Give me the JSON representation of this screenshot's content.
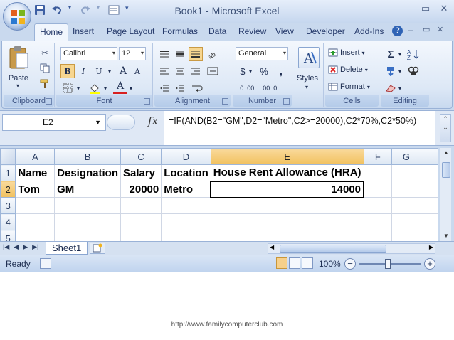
{
  "window": {
    "title": "Book1 - Microsoft Excel"
  },
  "ribbon": {
    "tabs": [
      "Home",
      "Insert",
      "Page Layout",
      "Formulas",
      "Data",
      "Review",
      "View",
      "Developer",
      "Add-Ins"
    ],
    "active_tab": "Home",
    "clipboard": {
      "label": "Clipboard",
      "paste": "Paste"
    },
    "font": {
      "label": "Font",
      "name": "Calibri",
      "size": "12",
      "bold": "B",
      "italic": "I",
      "underline": "U",
      "grow": "A",
      "shrink": "A",
      "color": "A"
    },
    "alignment": {
      "label": "Alignment"
    },
    "number": {
      "label": "Number",
      "format": "General",
      "currency": "$",
      "percent": "%",
      "comma": ",",
      "inc_decimal": ".0 .00",
      "dec_decimal": ".00 .0"
    },
    "styles": {
      "label": "Styles"
    },
    "cells": {
      "label": "Cells",
      "insert": "Insert",
      "delete": "Delete",
      "format": "Format"
    },
    "editing": {
      "label": "Editing",
      "sum": "Σ"
    }
  },
  "formula_bar": {
    "name_box": "E2",
    "fx": "fx",
    "formula": "=IF(AND(B2=\"GM\",D2=\"Metro\",C2>=20000),C2*70%,C2*50%)"
  },
  "sheet": {
    "columns": [
      "A",
      "B",
      "C",
      "D",
      "E",
      "F",
      "G"
    ],
    "selected_column": "E",
    "rows": [
      {
        "num": "1",
        "cells": [
          "Name",
          "Designation",
          "Salary",
          "Location",
          "House Rent Allowance (HRA)",
          "",
          ""
        ]
      },
      {
        "num": "2",
        "cells": [
          "Tom",
          "GM",
          "20000",
          "Metro",
          "14000",
          "",
          ""
        ]
      },
      {
        "num": "3",
        "cells": [
          "",
          "",
          "",
          "",
          "",
          "",
          ""
        ]
      },
      {
        "num": "4",
        "cells": [
          "",
          "",
          "",
          "",
          "",
          "",
          ""
        ]
      },
      {
        "num": "5",
        "cells": [
          "",
          "",
          "",
          "",
          "",
          "",
          ""
        ]
      }
    ],
    "active_cell": "E2",
    "tab_name": "Sheet1"
  },
  "status_bar": {
    "status": "Ready",
    "zoom": "100%",
    "zoom_minus": "−",
    "zoom_plus": "+"
  },
  "footer": {
    "url": "http://www.familycomputerclub.com"
  },
  "colors": {
    "ribbon_blue": "#c9d9ee",
    "selected_header": "#f1c15f",
    "gridline": "#d0d7e5"
  }
}
